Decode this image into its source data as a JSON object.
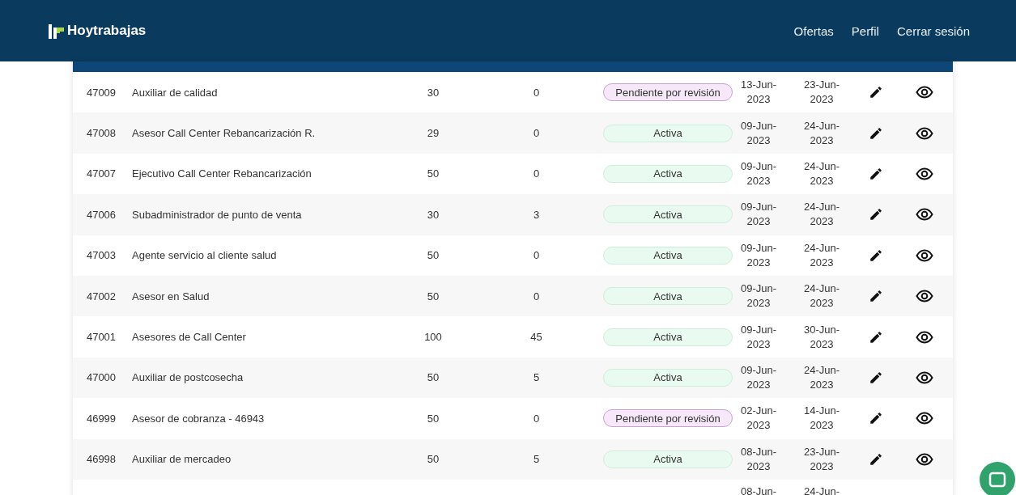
{
  "header": {
    "brand": "Hoytrabajas",
    "nav": [
      {
        "label": "Ofertas"
      },
      {
        "label": "Perfil"
      },
      {
        "label": "Cerrar sesión"
      }
    ]
  },
  "rows": [
    {
      "id": "47009",
      "title": "Auxiliar de calidad",
      "vacancies": "30",
      "applicants": "0",
      "status": {
        "label": "Pendiente por revisión",
        "kind": "pending"
      },
      "start": "13-Jun-2023",
      "end": "23-Jun-2023"
    },
    {
      "id": "47008",
      "title": "Asesor Call Center Rebancarización R.",
      "vacancies": "29",
      "applicants": "0",
      "status": {
        "label": "Activa",
        "kind": "active"
      },
      "start": "09-Jun-2023",
      "end": "24-Jun-2023"
    },
    {
      "id": "47007",
      "title": "Ejecutivo Call Center Rebancarización",
      "vacancies": "50",
      "applicants": "0",
      "status": {
        "label": "Activa",
        "kind": "active"
      },
      "start": "09-Jun-2023",
      "end": "24-Jun-2023"
    },
    {
      "id": "47006",
      "title": "Subadministrador de punto de venta",
      "vacancies": "30",
      "applicants": "3",
      "status": {
        "label": "Activa",
        "kind": "active"
      },
      "start": "09-Jun-2023",
      "end": "24-Jun-2023"
    },
    {
      "id": "47003",
      "title": "Agente servicio al cliente salud",
      "vacancies": "50",
      "applicants": "0",
      "status": {
        "label": "Activa",
        "kind": "active"
      },
      "start": "09-Jun-2023",
      "end": "24-Jun-2023"
    },
    {
      "id": "47002",
      "title": "Asesor en Salud",
      "vacancies": "50",
      "applicants": "0",
      "status": {
        "label": "Activa",
        "kind": "active"
      },
      "start": "09-Jun-2023",
      "end": "24-Jun-2023"
    },
    {
      "id": "47001",
      "title": "Asesores de Call Center",
      "vacancies": "100",
      "applicants": "45",
      "status": {
        "label": "Activa",
        "kind": "active"
      },
      "start": "09-Jun-2023",
      "end": "30-Jun-2023"
    },
    {
      "id": "47000",
      "title": "Auxiliar de postcosecha",
      "vacancies": "50",
      "applicants": "5",
      "status": {
        "label": "Activa",
        "kind": "active"
      },
      "start": "09-Jun-2023",
      "end": "24-Jun-2023"
    },
    {
      "id": "46999",
      "title": "Asesor de cobranza - 46943",
      "vacancies": "50",
      "applicants": "0",
      "status": {
        "label": "Pendiente por revisión",
        "kind": "pending"
      },
      "start": "02-Jun-2023",
      "end": "14-Jun-2023"
    },
    {
      "id": "46998",
      "title": "Auxiliar de mercadeo",
      "vacancies": "50",
      "applicants": "5",
      "status": {
        "label": "Activa",
        "kind": "active"
      },
      "start": "08-Jun-2023",
      "end": "23-Jun-2023"
    },
    {
      "start": "08-Jun-",
      "end": "24-Jun-"
    }
  ]
}
